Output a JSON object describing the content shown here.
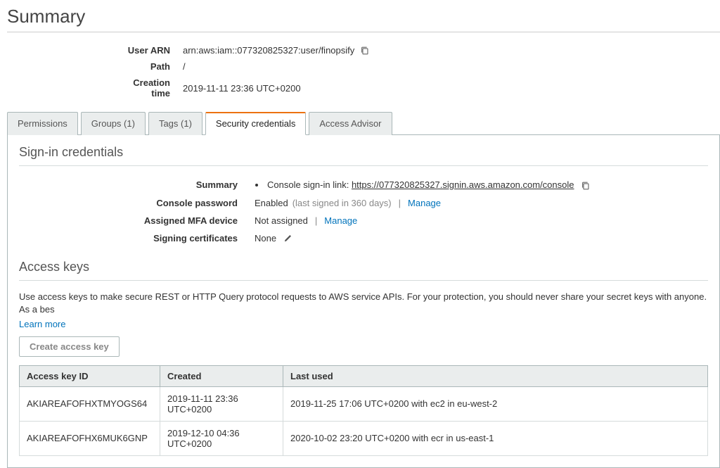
{
  "page_title": "Summary",
  "meta": {
    "user_arn_label": "User ARN",
    "user_arn_value": "arn:aws:iam::077320825327:user/finopsify",
    "path_label": "Path",
    "path_value": "/",
    "creation_time_label": "Creation time",
    "creation_time_value": "2019-11-11 23:36 UTC+0200"
  },
  "tabs": {
    "permissions": "Permissions",
    "groups": "Groups (1)",
    "tags": "Tags (1)",
    "security_credentials": "Security credentials",
    "access_advisor": "Access Advisor"
  },
  "signin": {
    "section_title": "Sign-in credentials",
    "summary_label": "Summary",
    "summary_prefix": "Console sign-in link: ",
    "summary_link": "https://077320825327.signin.aws.amazon.com/console",
    "console_password_label": "Console password",
    "console_password_value": "Enabled",
    "console_password_note": "(last signed in 360 days)",
    "manage": "Manage",
    "mfa_label": "Assigned MFA device",
    "mfa_value": "Not assigned",
    "signing_cert_label": "Signing certificates",
    "signing_cert_value": "None"
  },
  "access_keys": {
    "section_title": "Access keys",
    "description": "Use access keys to make secure REST or HTTP Query protocol requests to AWS service APIs. For your protection, you should never share your secret keys with anyone. As a bes",
    "learn_more": "Learn more",
    "create_btn": "Create access key",
    "columns": {
      "id": "Access key ID",
      "created": "Created",
      "last_used": "Last used"
    },
    "rows": [
      {
        "id": "AKIAREAFOFHXTMYOGS64",
        "created": "2019-11-11 23:36 UTC+0200",
        "last_used": "2019-11-25 17:06 UTC+0200 with ec2 in eu-west-2"
      },
      {
        "id": "AKIAREAFOFHX6MUK6GNP",
        "created": "2019-12-10 04:36 UTC+0200",
        "last_used": "2020-10-02 23:20 UTC+0200 with ecr in us-east-1"
      }
    ]
  }
}
